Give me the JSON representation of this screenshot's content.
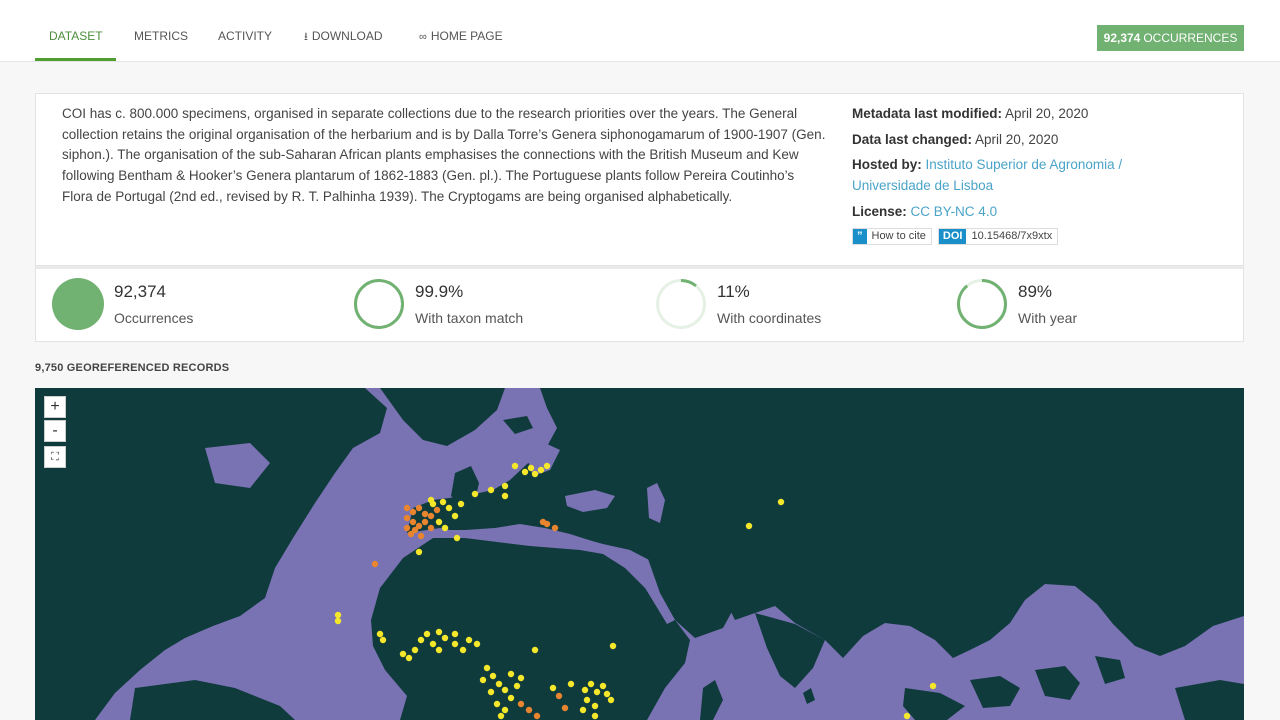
{
  "nav": {
    "tabs": [
      {
        "label": "DATASET",
        "active": true
      },
      {
        "label": "METRICS"
      },
      {
        "label": "ACTIVITY"
      },
      {
        "label": "DOWNLOAD",
        "icon": "download-icon"
      },
      {
        "label": "HOME PAGE",
        "icon": "link-icon"
      }
    ],
    "occurrences_count": "92,374",
    "occurrences_label": "OCCURRENCES"
  },
  "description": "COI has c. 800.000 specimens, organised in separate collections due to the research priorities over the years. The General collection retains the original organisation of the herbarium and is by Dalla Torre’s Genera siphonogamarum of 1900-1907 (Gen. siphon.). The organisation of the sub-Saharan African plants emphasises the connections with the British Museum and Kew following Bentham & Hooker’s Genera plantarum of 1862-1883 (Gen. pl.). The Portuguese plants follow Pereira Coutinho’s Flora de Portugal (2nd ed., revised by R. T. Palhinha 1939). The Cryptogams are being organised alphabetically.",
  "metadata": {
    "modified_label": "Metadata last modified:",
    "modified_value": "April 20, 2020",
    "changed_label": "Data last changed:",
    "changed_value": "April 20, 2020",
    "hosted_label": "Hosted by:",
    "hosted_value": "Instituto Superior de Agronomia / Universidade de Lisboa",
    "license_label": "License:",
    "license_value": "CC BY-NC 4.0",
    "cite_icon": "”",
    "cite_label": "How to cite",
    "doi_label": "DOI",
    "doi_value": "10.15468/7x9xtx"
  },
  "stats": [
    {
      "value": "92,374",
      "label": "Occurrences",
      "fraction": 1.0
    },
    {
      "value": "99.9%",
      "label": "With taxon match",
      "fraction": 0.999
    },
    {
      "value": "11%",
      "label": "With coordinates",
      "fraction": 0.11
    },
    {
      "value": "89%",
      "label": "With year",
      "fraction": 0.89
    }
  ],
  "map": {
    "title": "9,750 GEOREFERENCED RECORDS",
    "zoom_in": "+",
    "zoom_out": "-",
    "colors": {
      "ocean": "#7a73b3",
      "land": "#0f3b3c",
      "dot_low": "#f5e82a",
      "dot_high": "#e8852e"
    }
  },
  "colors": {
    "accent": "#509e2f",
    "button": "#71b171",
    "link": "#4aa3c8",
    "doi": "#1a8fc9"
  }
}
